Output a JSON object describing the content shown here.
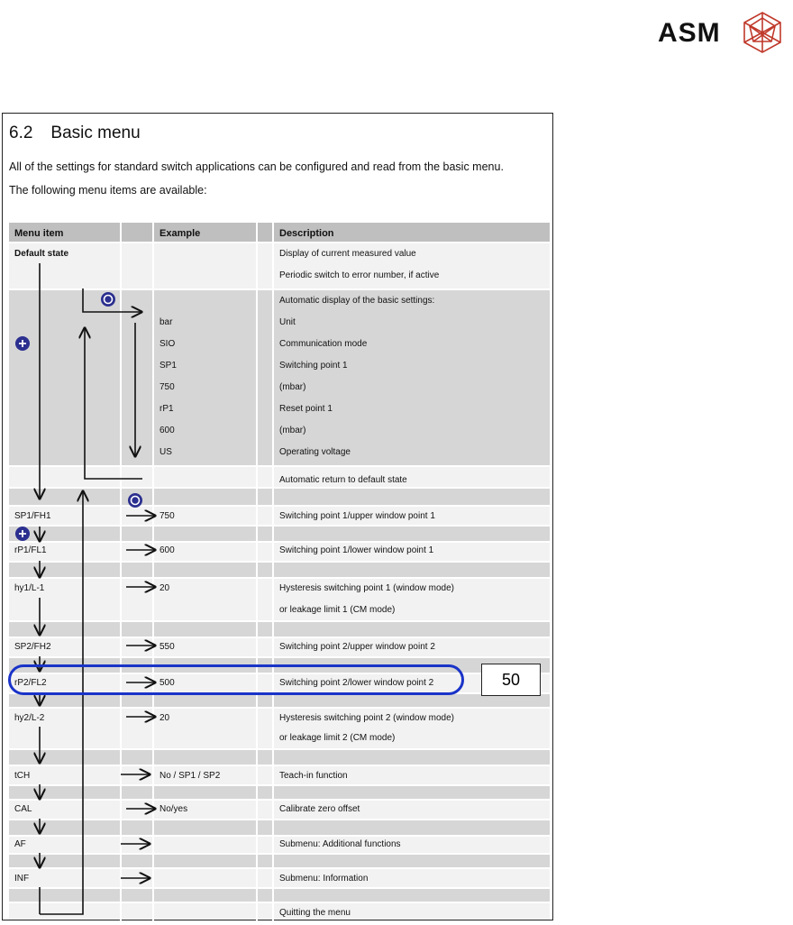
{
  "logo": {
    "text": "ASM"
  },
  "section": {
    "number": "6.2",
    "title": "Basic menu"
  },
  "intro": [
    "All of the settings for standard switch applications can be configured and read from the basic menu.",
    "The following menu items are available:"
  ],
  "table": {
    "headers": {
      "menu_item": "Menu item",
      "example": "Example",
      "description": "Description"
    },
    "default_state": {
      "label": "Default state",
      "desc": [
        "Display of current measured value",
        "Periodic switch to error number, if active"
      ]
    },
    "auto_display": {
      "title": "Automatic display of the basic settings:",
      "rows": [
        {
          "example": "bar",
          "desc": "Unit"
        },
        {
          "example": "SIO",
          "desc": "Communication mode"
        },
        {
          "example": "SP1",
          "desc": "Switching point 1"
        },
        {
          "example": "750",
          "desc": "(mbar)"
        },
        {
          "example": "rP1",
          "desc": "Reset point 1"
        },
        {
          "example": "600",
          "desc": "(mbar)"
        },
        {
          "example": "US",
          "desc": "Operating voltage"
        }
      ],
      "return_text": "Automatic return to default state"
    },
    "items": [
      {
        "item": "SP1/FH1",
        "example": "750",
        "desc": [
          "Switching point 1/upper window point 1"
        ]
      },
      {
        "item": "rP1/FL1",
        "example": "600",
        "desc": [
          "Switching point 1/lower window point 1"
        ]
      },
      {
        "item": "hy1/L-1",
        "example": "20",
        "desc": [
          "Hysteresis switching point 1 (window mode)",
          "or leakage limit 1 (CM mode)"
        ]
      },
      {
        "item": "SP2/FH2",
        "example": "550",
        "desc": [
          "Switching point 2/upper window point 2"
        ]
      },
      {
        "item": "rP2/FL2",
        "example": "500",
        "desc": [
          "Switching point 2/lower window point 2"
        ]
      },
      {
        "item": "hy2/L-2",
        "example": "20",
        "desc": [
          "Hysteresis switching point 2 (window mode)",
          "or leakage limit 2 (CM mode)"
        ]
      },
      {
        "item": "tCH",
        "example": "No / SP1 / SP2",
        "desc": [
          "Teach-in function"
        ]
      },
      {
        "item": "CAL",
        "example": "No/yes",
        "desc": [
          "Calibrate zero offset"
        ]
      },
      {
        "item": "AF",
        "example": "",
        "desc": [
          "Submenu: Additional functions"
        ]
      },
      {
        "item": "INF",
        "example": "",
        "desc": [
          "Submenu: Information"
        ]
      }
    ],
    "quit_text": "Quitting the menu"
  },
  "highlight": {
    "page_number": "50"
  },
  "colors": {
    "callout": "#1a33c8",
    "band_dark": "#d6d6d6",
    "band_light": "#f2f2f2",
    "header": "#bfbfbf",
    "button": "#2b2f8f"
  },
  "icons": [
    "asm-crystal-logo-icon",
    "set-button-icon",
    "plus-button-icon",
    "arrow-right-icon",
    "arrow-down-icon",
    "arrow-up-icon"
  ]
}
